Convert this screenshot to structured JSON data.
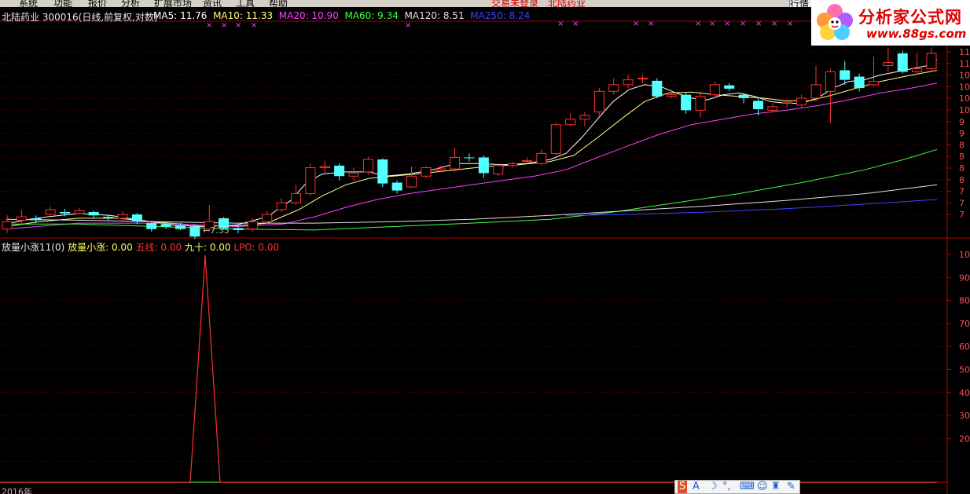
{
  "menu": {
    "items": [
      "系统",
      "功能",
      "报价",
      "分析",
      "扩展市场",
      "资讯",
      "工具",
      "帮助"
    ],
    "center_items": [
      "交易未登录",
      "北陆药业"
    ],
    "right_items": [
      "行",
      "情"
    ]
  },
  "logo": {
    "title": "分析家公式网",
    "url": "www.88gs.com"
  },
  "header": {
    "stock_name": "北陆药业",
    "stock_code": "300016",
    "period": "(日线,前复权,对数)",
    "ma": [
      {
        "label": "MA5",
        "value": "11.76",
        "color": "#ffffff"
      },
      {
        "label": "MA10",
        "value": "11.33",
        "color": "#ffff80"
      },
      {
        "label": "MA20",
        "value": "10.90",
        "color": "#ff40ff"
      },
      {
        "label": "MA60",
        "value": "9.34",
        "color": "#40ff40"
      },
      {
        "label": "MA120",
        "value": "8.51",
        "color": "#e0e0e0"
      },
      {
        "label": "MA250",
        "value": "8.24",
        "color": "#4040ff"
      }
    ]
  },
  "low_marker": "←7.35",
  "indicator": {
    "name": "放量小涨11(0)",
    "fields": [
      {
        "label": "放量小涨",
        "value": "0.00",
        "color": "#ffff60"
      },
      {
        "label": "五线",
        "value": "0.00",
        "color": "#ff3030"
      },
      {
        "label": "九十",
        "value": "0.00",
        "color": "#ffff60"
      },
      {
        "label": "LPO",
        "value": "0.00",
        "color": "#ff3030"
      }
    ]
  },
  "date_label": "2016年",
  "price_axis_labels": [
    "11",
    "11",
    "10",
    "10",
    "10",
    "10",
    "9",
    "9",
    "8",
    "8",
    "8",
    "8",
    "7",
    "7",
    "7"
  ],
  "indicator_axis_labels": [
    "10",
    "90",
    "80",
    "70",
    "60",
    "50",
    "40",
    "30",
    "20"
  ],
  "colors": {
    "up": "#ff3232",
    "down": "#54ffff",
    "grid": "#800000",
    "ma5": "#ffffff",
    "ma10": "#ffff80",
    "ma20": "#ff40ff",
    "ma60": "#40ff40",
    "ma120": "#e0e0e0",
    "ma250": "#4040ff"
  },
  "chart_data": {
    "type": "candlestick",
    "ylim": [
      6.9,
      12.3
    ],
    "log_scale": true,
    "candles": [
      {
        "o": 7.0,
        "c": 7.15,
        "h": 7.28,
        "l": 6.92
      },
      {
        "o": 7.18,
        "c": 7.25,
        "h": 7.4,
        "l": 7.1
      },
      {
        "o": 7.22,
        "c": 7.18,
        "h": 7.28,
        "l": 7.12
      },
      {
        "o": 7.3,
        "c": 7.4,
        "h": 7.46,
        "l": 7.28
      },
      {
        "o": 7.35,
        "c": 7.32,
        "h": 7.42,
        "l": 7.26
      },
      {
        "o": 7.32,
        "c": 7.38,
        "h": 7.44,
        "l": 7.3
      },
      {
        "o": 7.35,
        "c": 7.28,
        "h": 7.38,
        "l": 7.22
      },
      {
        "o": 7.25,
        "c": 7.22,
        "h": 7.3,
        "l": 7.18
      },
      {
        "o": 7.22,
        "c": 7.3,
        "h": 7.36,
        "l": 7.16
      },
      {
        "o": 7.3,
        "c": 7.15,
        "h": 7.33,
        "l": 7.1
      },
      {
        "o": 7.12,
        "c": 7.0,
        "h": 7.16,
        "l": 6.95
      },
      {
        "o": 7.1,
        "c": 7.05,
        "h": 7.15,
        "l": 7.0
      },
      {
        "o": 7.08,
        "c": 7.0,
        "h": 7.12,
        "l": 6.98
      },
      {
        "o": 7.05,
        "c": 6.85,
        "h": 7.08,
        "l": 6.8
      },
      {
        "o": 7.0,
        "c": 7.15,
        "h": 7.5,
        "l": 6.95
      },
      {
        "o": 7.22,
        "c": 7.02,
        "h": 7.25,
        "l": 6.98
      },
      {
        "o": 7.02,
        "c": 6.98,
        "h": 7.05,
        "l": 6.92
      },
      {
        "o": 7.0,
        "c": 7.15,
        "h": 7.22,
        "l": 6.95
      },
      {
        "o": 7.15,
        "c": 7.3,
        "h": 7.38,
        "l": 7.1
      },
      {
        "o": 7.4,
        "c": 7.55,
        "h": 7.65,
        "l": 7.35
      },
      {
        "o": 7.55,
        "c": 7.75,
        "h": 7.95,
        "l": 7.5
      },
      {
        "o": 7.75,
        "c": 8.35,
        "h": 8.45,
        "l": 7.7
      },
      {
        "o": 8.35,
        "c": 8.38,
        "h": 8.52,
        "l": 8.2
      },
      {
        "o": 8.4,
        "c": 8.15,
        "h": 8.45,
        "l": 8.05
      },
      {
        "o": 8.15,
        "c": 8.22,
        "h": 8.35,
        "l": 8.05
      },
      {
        "o": 8.25,
        "c": 8.55,
        "h": 8.62,
        "l": 8.18
      },
      {
        "o": 8.55,
        "c": 7.98,
        "h": 8.58,
        "l": 7.9
      },
      {
        "o": 8.0,
        "c": 7.82,
        "h": 8.05,
        "l": 7.75
      },
      {
        "o": 7.9,
        "c": 8.15,
        "h": 8.38,
        "l": 7.88
      },
      {
        "o": 8.15,
        "c": 8.35,
        "h": 8.4,
        "l": 8.1
      },
      {
        "o": 8.28,
        "c": 8.32,
        "h": 8.4,
        "l": 8.25
      },
      {
        "o": 8.32,
        "c": 8.6,
        "h": 8.85,
        "l": 8.25
      },
      {
        "o": 8.6,
        "c": 8.58,
        "h": 8.7,
        "l": 8.5
      },
      {
        "o": 8.6,
        "c": 8.22,
        "h": 8.65,
        "l": 8.1
      },
      {
        "o": 8.2,
        "c": 8.4,
        "h": 8.45,
        "l": 8.15
      },
      {
        "o": 8.4,
        "c": 8.45,
        "h": 8.5,
        "l": 8.35
      },
      {
        "o": 8.52,
        "c": 8.52,
        "h": 8.6,
        "l": 8.45
      },
      {
        "o": 8.45,
        "c": 8.7,
        "h": 8.8,
        "l": 8.4
      },
      {
        "o": 8.7,
        "c": 9.45,
        "h": 9.5,
        "l": 8.65
      },
      {
        "o": 9.45,
        "c": 9.6,
        "h": 9.75,
        "l": 9.4
      },
      {
        "o": 9.6,
        "c": 9.7,
        "h": 9.8,
        "l": 9.4
      },
      {
        "o": 9.8,
        "c": 10.4,
        "h": 10.5,
        "l": 9.7
      },
      {
        "o": 10.4,
        "c": 10.6,
        "h": 10.8,
        "l": 10.3
      },
      {
        "o": 10.6,
        "c": 10.75,
        "h": 10.9,
        "l": 10.5
      },
      {
        "o": 10.8,
        "c": 10.8,
        "h": 10.9,
        "l": 10.65
      },
      {
        "o": 10.72,
        "c": 10.25,
        "h": 10.8,
        "l": 10.2
      },
      {
        "o": 10.25,
        "c": 10.3,
        "h": 10.45,
        "l": 10.2
      },
      {
        "o": 10.3,
        "c": 9.85,
        "h": 10.35,
        "l": 9.75
      },
      {
        "o": 9.85,
        "c": 10.25,
        "h": 10.4,
        "l": 9.65
      },
      {
        "o": 10.3,
        "c": 10.6,
        "h": 10.7,
        "l": 10.2
      },
      {
        "o": 10.58,
        "c": 10.48,
        "h": 10.65,
        "l": 10.4
      },
      {
        "o": 10.3,
        "c": 10.2,
        "h": 10.35,
        "l": 10.05
      },
      {
        "o": 10.12,
        "c": 9.88,
        "h": 10.2,
        "l": 9.7
      },
      {
        "o": 9.85,
        "c": 9.95,
        "h": 10.05,
        "l": 9.8
      },
      {
        "o": 10.05,
        "c": 10.08,
        "h": 10.15,
        "l": 9.95
      },
      {
        "o": 10.0,
        "c": 10.2,
        "h": 10.3,
        "l": 9.9
      },
      {
        "o": 10.2,
        "c": 10.6,
        "h": 11.2,
        "l": 10.1
      },
      {
        "o": 10.4,
        "c": 11.0,
        "h": 11.1,
        "l": 9.5
      },
      {
        "o": 11.05,
        "c": 10.75,
        "h": 11.35,
        "l": 10.6
      },
      {
        "o": 10.85,
        "c": 10.5,
        "h": 10.95,
        "l": 10.4
      },
      {
        "o": 10.6,
        "c": 10.7,
        "h": 11.5,
        "l": 10.55
      },
      {
        "o": 11.2,
        "c": 11.3,
        "h": 11.8,
        "l": 11.0
      },
      {
        "o": 11.6,
        "c": 11.0,
        "h": 11.7,
        "l": 10.95
      },
      {
        "o": 11.0,
        "c": 11.1,
        "h": 11.6,
        "l": 10.9
      },
      {
        "o": 11.1,
        "c": 11.6,
        "h": 11.8,
        "l": 11.0
      }
    ],
    "ma": {
      "ma5": [
        [
          8,
          7.1
        ],
        [
          30,
          7.18
        ],
        [
          60,
          7.25
        ],
        [
          100,
          7.32
        ],
        [
          140,
          7.28
        ],
        [
          180,
          7.18
        ],
        [
          220,
          7.08
        ],
        [
          260,
          7.05
        ],
        [
          300,
          7.08
        ],
        [
          340,
          7.25
        ],
        [
          370,
          7.6
        ],
        [
          390,
          8.0
        ],
        [
          410,
          8.2
        ],
        [
          440,
          8.25
        ],
        [
          470,
          8.25
        ],
        [
          490,
          8.15
        ],
        [
          520,
          8.2
        ],
        [
          550,
          8.3
        ],
        [
          580,
          8.45
        ],
        [
          610,
          8.45
        ],
        [
          640,
          8.42
        ],
        [
          670,
          8.45
        ],
        [
          700,
          8.55
        ],
        [
          720,
          8.7
        ],
        [
          740,
          9.1
        ],
        [
          760,
          9.6
        ],
        [
          780,
          10.1
        ],
        [
          800,
          10.45
        ],
        [
          820,
          10.6
        ],
        [
          840,
          10.55
        ],
        [
          860,
          10.35
        ],
        [
          880,
          10.2
        ],
        [
          900,
          10.15
        ],
        [
          920,
          10.3
        ],
        [
          940,
          10.35
        ],
        [
          960,
          10.25
        ],
        [
          980,
          10.1
        ],
        [
          1000,
          10.05
        ],
        [
          1020,
          10.05
        ],
        [
          1040,
          10.2
        ],
        [
          1060,
          10.5
        ],
        [
          1080,
          10.7
        ],
        [
          1100,
          10.75
        ],
        [
          1120,
          10.9
        ],
        [
          1150,
          11.05
        ],
        [
          1180,
          11.2
        ],
        [
          1192,
          11.4
        ]
      ],
      "ma10": [
        [
          8,
          7.05
        ],
        [
          50,
          7.15
        ],
        [
          100,
          7.22
        ],
        [
          150,
          7.22
        ],
        [
          200,
          7.14
        ],
        [
          250,
          7.08
        ],
        [
          300,
          7.06
        ],
        [
          340,
          7.12
        ],
        [
          380,
          7.4
        ],
        [
          410,
          7.7
        ],
        [
          440,
          7.95
        ],
        [
          470,
          8.1
        ],
        [
          500,
          8.15
        ],
        [
          540,
          8.22
        ],
        [
          580,
          8.3
        ],
        [
          620,
          8.38
        ],
        [
          660,
          8.42
        ],
        [
          700,
          8.5
        ],
        [
          730,
          8.65
        ],
        [
          760,
          9.1
        ],
        [
          790,
          9.6
        ],
        [
          820,
          10.1
        ],
        [
          850,
          10.35
        ],
        [
          880,
          10.38
        ],
        [
          910,
          10.3
        ],
        [
          940,
          10.25
        ],
        [
          970,
          10.2
        ],
        [
          1000,
          10.12
        ],
        [
          1030,
          10.12
        ],
        [
          1060,
          10.3
        ],
        [
          1090,
          10.5
        ],
        [
          1120,
          10.7
        ],
        [
          1150,
          10.85
        ],
        [
          1192,
          11.05
        ]
      ],
      "ma20": [
        [
          8,
          7.0
        ],
        [
          100,
          7.12
        ],
        [
          200,
          7.12
        ],
        [
          300,
          7.05
        ],
        [
          360,
          7.1
        ],
        [
          400,
          7.25
        ],
        [
          440,
          7.45
        ],
        [
          480,
          7.62
        ],
        [
          520,
          7.75
        ],
        [
          560,
          7.85
        ],
        [
          600,
          7.95
        ],
        [
          640,
          8.05
        ],
        [
          680,
          8.15
        ],
        [
          720,
          8.3
        ],
        [
          760,
          8.6
        ],
        [
          800,
          8.9
        ],
        [
          840,
          9.2
        ],
        [
          880,
          9.45
        ],
        [
          920,
          9.6
        ],
        [
          960,
          9.75
        ],
        [
          1000,
          9.85
        ],
        [
          1040,
          9.98
        ],
        [
          1080,
          10.15
        ],
        [
          1120,
          10.35
        ],
        [
          1160,
          10.5
        ],
        [
          1192,
          10.65
        ]
      ],
      "ma60": [
        [
          8,
          7.1
        ],
        [
          100,
          7.1
        ],
        [
          200,
          7.05
        ],
        [
          300,
          7.0
        ],
        [
          400,
          6.98
        ],
        [
          500,
          7.05
        ],
        [
          600,
          7.12
        ],
        [
          700,
          7.2
        ],
        [
          780,
          7.35
        ],
        [
          860,
          7.55
        ],
        [
          940,
          7.75
        ],
        [
          1020,
          8.0
        ],
        [
          1100,
          8.3
        ],
        [
          1150,
          8.55
        ],
        [
          1192,
          8.8
        ]
      ],
      "ma120": [
        [
          8,
          7.2
        ],
        [
          100,
          7.18
        ],
        [
          200,
          7.15
        ],
        [
          300,
          7.12
        ],
        [
          400,
          7.12
        ],
        [
          500,
          7.15
        ],
        [
          600,
          7.2
        ],
        [
          700,
          7.28
        ],
        [
          800,
          7.38
        ],
        [
          900,
          7.48
        ],
        [
          1000,
          7.6
        ],
        [
          1100,
          7.75
        ],
        [
          1192,
          7.95
        ]
      ],
      "ma250": [
        [
          720,
          7.28
        ],
        [
          800,
          7.3
        ],
        [
          900,
          7.35
        ],
        [
          1000,
          7.42
        ],
        [
          1100,
          7.52
        ],
        [
          1192,
          7.62
        ]
      ]
    },
    "indicator": {
      "type": "line",
      "ylim": [
        0,
        100
      ],
      "points": [
        [
          0,
          0
        ],
        [
          242,
          0
        ],
        [
          261,
          100
        ],
        [
          280,
          0
        ],
        [
          1192,
          0
        ]
      ]
    }
  }
}
